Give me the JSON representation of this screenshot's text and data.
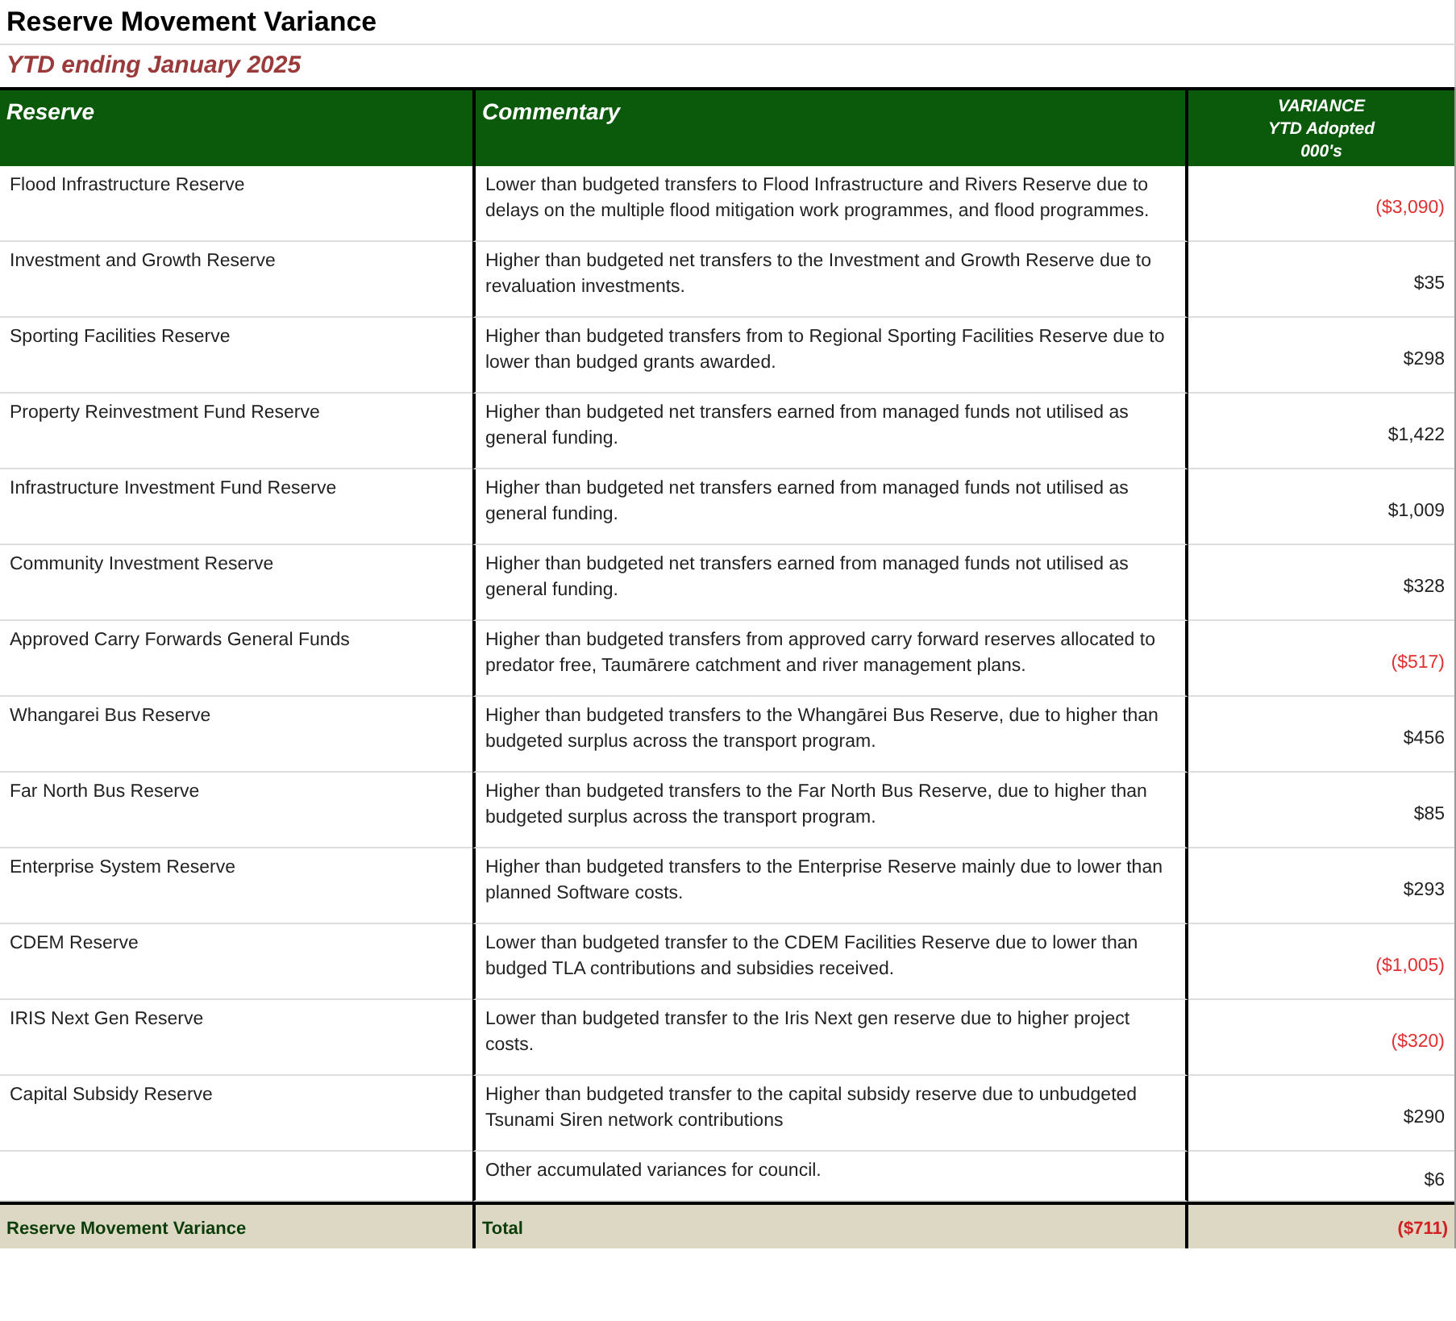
{
  "title": "Reserve Movement Variance",
  "subtitle": "YTD ending January 2025",
  "columns": [
    {
      "label": "Reserve",
      "kind": "left"
    },
    {
      "label": "Commentary",
      "kind": "left"
    },
    {
      "label": "VARIANCE\nYTD Adopted\n000's",
      "kind": "center"
    }
  ],
  "rows": [
    {
      "reserve": "Flood Infrastructure Reserve",
      "commentary": "Lower than budgeted transfers to Flood Infrastructure and Rivers Reserve due to delays on the  multiple flood mitigation work programmes, and flood programmes.",
      "variance": "($3,090)",
      "negative": true
    },
    {
      "reserve": "Investment and Growth Reserve",
      "commentary": "Higher than budgeted net transfers to the Investment and Growth Reserve due to revaluation investments.",
      "variance": "$35",
      "negative": false
    },
    {
      "reserve": "Sporting Facilities Reserve",
      "commentary": "Higher than budgeted transfers from to  Regional Sporting Facilities Reserve due to lower than budged grants awarded.",
      "variance": "$298",
      "negative": false
    },
    {
      "reserve": "Property Reinvestment Fund Reserve",
      "commentary": "Higher than budgeted net transfers earned from managed funds not utilised as general funding.",
      "variance": "$1,422",
      "negative": false
    },
    {
      "reserve": "Infrastructure Investment Fund Reserve",
      "commentary": "Higher than budgeted net transfers earned from managed funds not utilised as general funding.",
      "variance": "$1,009",
      "negative": false
    },
    {
      "reserve": "Community Investment Reserve",
      "commentary": "Higher than budgeted net transfers earned from managed funds not utilised as general funding.",
      "variance": "$328",
      "negative": false
    },
    {
      "reserve": "Approved Carry Forwards General Funds",
      "commentary": "Higher than budgeted transfers from approved carry forward reserves allocated to  predator free, Taumārere catchment and river management plans.",
      "variance": "($517)",
      "negative": true
    },
    {
      "reserve": "Whangarei Bus Reserve",
      "commentary": "Higher than budgeted transfers to the  Whangārei Bus Reserve, due to higher than budgeted surplus across the transport program.",
      "variance": "$456",
      "negative": false
    },
    {
      "reserve": "Far North Bus Reserve",
      "commentary": "Higher than budgeted transfers to the Far North  Bus Reserve, due to higher than budgeted surplus across the transport program.",
      "variance": "$85",
      "negative": false
    },
    {
      "reserve": "Enterprise System Reserve",
      "commentary": "Higher than budgeted transfers to the Enterprise Reserve mainly due to lower than planned Software costs.",
      "variance": "$293",
      "negative": false
    },
    {
      "reserve": "CDEM Reserve",
      "commentary": "Lower than budgeted transfer  to the CDEM Facilities Reserve due to lower than budged TLA contributions and subsidies received.",
      "variance": "($1,005)",
      "negative": true
    },
    {
      "reserve": "IRIS Next Gen Reserve",
      "commentary": "Lower than budgeted transfer to  the Iris Next gen reserve due to higher project costs.",
      "variance": "($320)",
      "negative": true
    },
    {
      "reserve": "Capital Subsidy Reserve",
      "commentary": "Higher than budgeted transfer to the capital subsidy reserve due to unbudgeted Tsunami Siren network contributions",
      "variance": "$290",
      "negative": false
    },
    {
      "commentary": "Other accumulated variances for council.",
      "variance": "$6",
      "negative": false
    }
  ],
  "total": {
    "reserve": "Reserve Movement Variance",
    "commentary": "Total",
    "variance": "($711)",
    "negative": true
  }
}
